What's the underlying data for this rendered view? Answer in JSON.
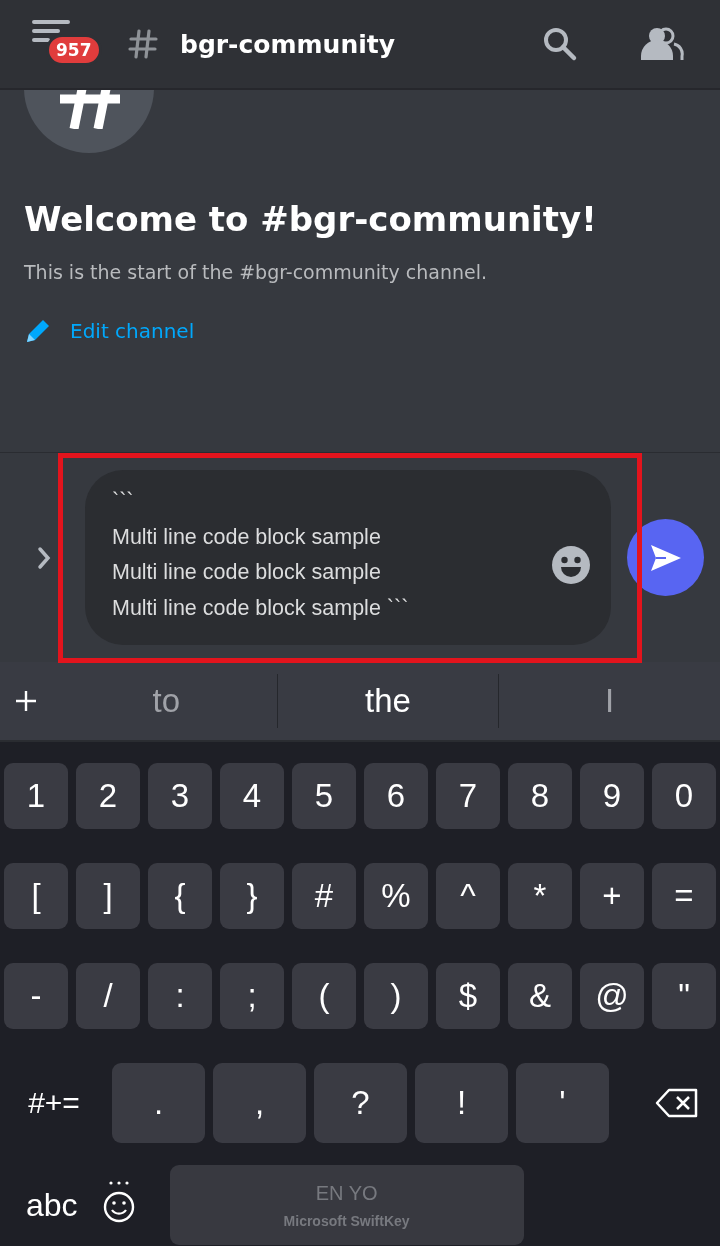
{
  "header": {
    "unread_badge": "957",
    "channel_name": "bgr-community"
  },
  "welcome": {
    "title": "Welcome to #bgr-community!",
    "description": "This is the start of the #bgr-community channel.",
    "edit_link": "Edit channel"
  },
  "composer": {
    "value": "```\nMulti line code block sample\nMulti line code block sample\nMulti line code block sample ```",
    "highlighted": true
  },
  "suggestions": [
    {
      "text": "to",
      "selected": false
    },
    {
      "text": "the",
      "selected": true
    },
    {
      "text": "I",
      "selected": false
    }
  ],
  "keyboard": {
    "rows": [
      [
        "1",
        "2",
        "3",
        "4",
        "5",
        "6",
        "7",
        "8",
        "9",
        "0"
      ],
      [
        "[",
        "]",
        "{",
        "}",
        "#",
        "%",
        "^",
        "*",
        "+",
        "="
      ],
      [
        "-",
        "/",
        ":",
        ";",
        "(",
        ")",
        "$",
        "&",
        "@",
        "\""
      ]
    ],
    "punctuation_keys": [
      ".",
      ",",
      "?",
      "!",
      "'"
    ],
    "symbols_key": "#+=",
    "mode_key": "abc",
    "space_key": {
      "language": "EN YO",
      "brand": "Microsoft SwiftKey"
    }
  }
}
